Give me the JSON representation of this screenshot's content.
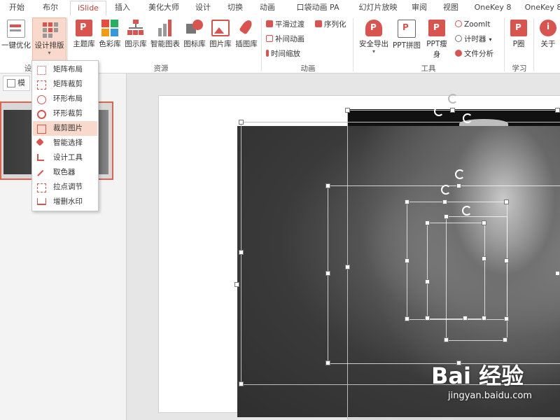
{
  "tabs": [
    "开始",
    "布尔",
    "iSlide",
    "插入",
    "美化大师",
    "设计",
    "切换",
    "动画",
    "口袋动画 PA",
    "幻灯片放映",
    "审阅",
    "视图",
    "OneKey 8",
    "OneKey 8"
  ],
  "active_tab": "iSlide",
  "ribbon": {
    "buttons": {
      "onekey": "一键优化",
      "design_layout": "设计排版",
      "theme": "主题库",
      "color": "色彩库",
      "diagram": "图示库",
      "smart_chart": "智能图表",
      "icon": "图标库",
      "picture": "图片库",
      "illustration": "插图库",
      "export": "安全导出",
      "ppt_stitch": "PPT拼图",
      "ppt_slim": "PPT瘦身",
      "p_circle": "P圈",
      "about": "关于"
    },
    "small": {
      "smooth": "平滑过渡",
      "sequence": "序列化",
      "tween": "补间动画",
      "time_scale": "时间缩放",
      "zoomit": "ZoomIt",
      "timer": "计时器",
      "file_analysis": "文件分析"
    },
    "groups": {
      "design": "设",
      "resources": "资源",
      "animation": "动画",
      "tools": "工具",
      "learn": "学习"
    }
  },
  "left_pane": {
    "tab_label": "模"
  },
  "menu": {
    "items": [
      "矩阵布局",
      "矩阵裁剪",
      "环形布局",
      "环形裁剪",
      "裁剪图片",
      "智能选择",
      "设计工具",
      "取色器",
      "拉点调节",
      "增删水印"
    ],
    "highlighted": "裁剪图片"
  },
  "watermark": {
    "text": "Bai 经验",
    "url": "jingyan.baidu.com"
  },
  "colors": {
    "accent": "#c7403a",
    "highlight": "#f9d9cb"
  }
}
